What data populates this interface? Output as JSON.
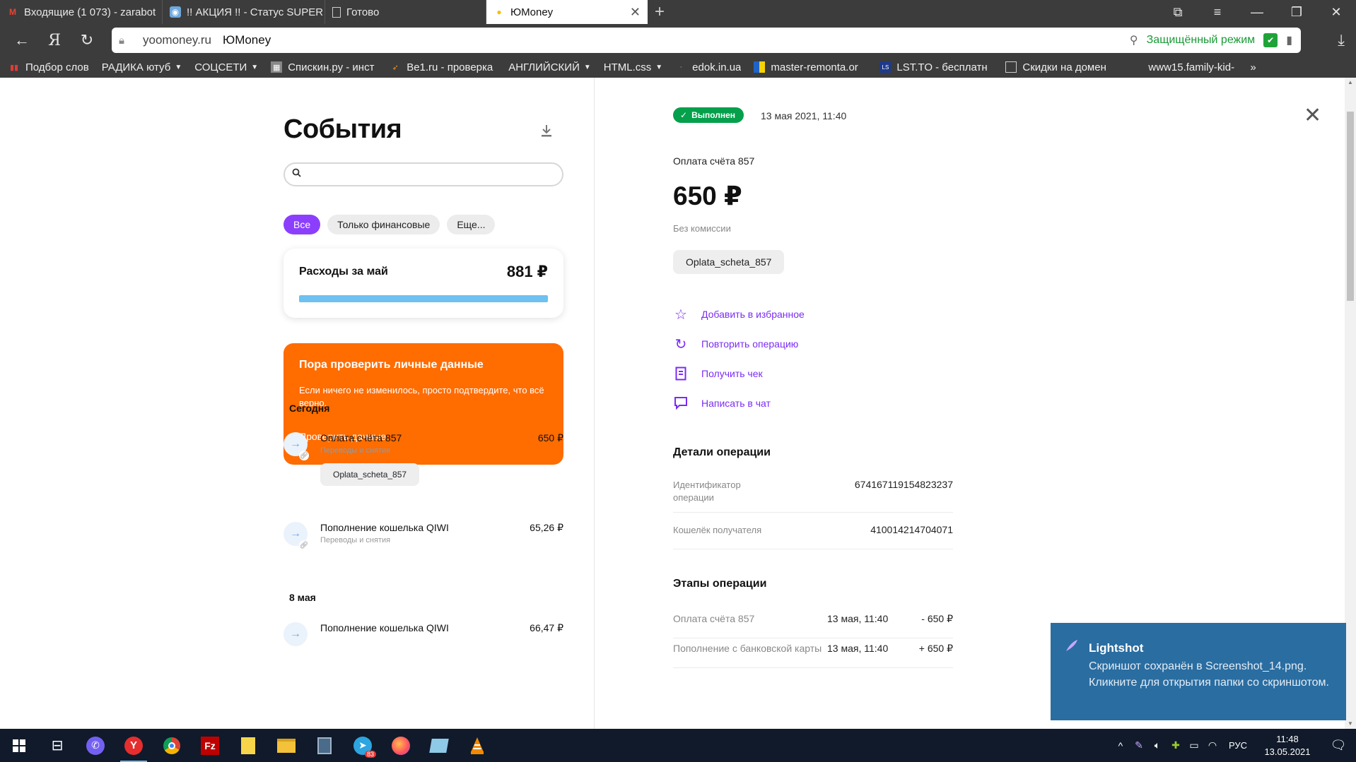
{
  "browser": {
    "tabs": [
      {
        "title": "Входящие (1 073) - zarabot",
        "icon": "gmail-icon",
        "active": false
      },
      {
        "title": "!! АКЦИЯ !! - Статус SUPER",
        "icon": "site-icon",
        "active": false
      },
      {
        "title": "Готово",
        "icon": "page-icon",
        "active": false
      },
      {
        "title": "ЮMoney",
        "icon": "yoomoney-icon",
        "active": true
      }
    ],
    "url_host": "yoomoney.ru",
    "page_title": "ЮMoney",
    "protected_mode": "Защищённый режим",
    "bookmarks": [
      {
        "label": "Подбор слов",
        "icon": "chart-icon",
        "dropdown": false
      },
      {
        "label": "РАДИКА ютуб",
        "icon": "",
        "dropdown": true
      },
      {
        "label": "СОЦСЕТИ",
        "icon": "",
        "dropdown": true
      },
      {
        "label": "Спискин.ру - инст",
        "icon": "site-icon",
        "dropdown": false
      },
      {
        "label": "Be1.ru - проверка",
        "icon": "rocket-icon",
        "dropdown": false
      },
      {
        "label": "АНГЛИЙСКИЙ",
        "icon": "",
        "dropdown": true
      },
      {
        "label": "HTML.css",
        "icon": "",
        "dropdown": true
      },
      {
        "label": "edok.in.ua",
        "icon": "site-icon",
        "dropdown": false
      },
      {
        "label": "master-remonta.or",
        "icon": "flag-icon",
        "dropdown": false
      },
      {
        "label": "LST.TO - бесплатн",
        "icon": "site-icon",
        "dropdown": false
      },
      {
        "label": "Скидки на домен",
        "icon": "page-icon",
        "dropdown": false
      },
      {
        "label": "www15.family-kid-",
        "icon": "",
        "dropdown": false
      }
    ]
  },
  "feed": {
    "title": "События",
    "filters": [
      "Все",
      "Только финансовые",
      "Еще..."
    ],
    "expense": {
      "label": "Расходы за май",
      "amount": "881 ₽",
      "progress": 1.0
    },
    "promo": {
      "title": "Пора проверить личные данные",
      "text": "Если ничего не изменилось, просто подтвердите, что всё верно.",
      "action": "Проверить данные"
    },
    "groups": [
      {
        "day": "Сегодня",
        "items": [
          {
            "title": "Оплата счёта 857",
            "category": "Переводы и снятия",
            "amount": "650 ₽",
            "tag": "Oplata_scheta_857"
          },
          {
            "title": "Пополнение кошелька QIWI",
            "category": "Переводы и снятия",
            "amount": "65,26 ₽",
            "tag": ""
          }
        ]
      },
      {
        "day": "8 мая",
        "items": [
          {
            "title": "Пополнение кошелька QIWI",
            "category": "",
            "amount": "66,47 ₽",
            "tag": ""
          }
        ]
      }
    ]
  },
  "detail": {
    "status": "Выполнен",
    "status_color": "#04a04b",
    "date": "13 мая 2021, 11:40",
    "title": "Оплата счёта 857",
    "amount": "650 ₽",
    "fee": "Без комиссии",
    "tag": "Oplata_scheta_857",
    "actions": [
      {
        "label": "Добавить в избранное",
        "icon": "star-icon"
      },
      {
        "label": "Повторить операцию",
        "icon": "repeat-icon"
      },
      {
        "label": "Получить чек",
        "icon": "receipt-icon"
      },
      {
        "label": "Написать в чат",
        "icon": "chat-icon"
      }
    ],
    "details_title": "Детали операции",
    "details": [
      {
        "key": "Идентификатор операции",
        "value": "674167119154823237"
      },
      {
        "key": "Кошелёк получателя",
        "value": "410014214704071"
      }
    ],
    "stages_title": "Этапы операции",
    "stages": [
      {
        "name": "Оплата счёта 857",
        "time": "13 мая, 11:40",
        "sum": "- 650 ₽"
      },
      {
        "name": "Пополнение с банковской карты",
        "time": "13 мая, 11:40",
        "sum": "+ 650 ₽"
      }
    ]
  },
  "toast": {
    "app": "Lightshot",
    "text": "Скриншот сохранён в Screenshot_14.png. Кликните для открытия папки со скриншотом."
  },
  "taskbar": {
    "apps": [
      "windows-start-icon",
      "task-view-icon",
      "viber-icon",
      "yandex-browser-icon",
      "chrome-icon",
      "filezilla-icon",
      "notepad-icon",
      "file-explorer-icon",
      "calculator-icon",
      "telegram-icon",
      "firefox-icon",
      "notes-icon",
      "vlc-icon"
    ],
    "telegram_badge": "83",
    "lang": "РУС",
    "time": "11:48",
    "date": "13.05.2021"
  },
  "colors": {
    "accent": "#8b3ffd",
    "promo": "#ff6c00",
    "progress": "#6ec1f0",
    "link": "#7a2cf5"
  }
}
